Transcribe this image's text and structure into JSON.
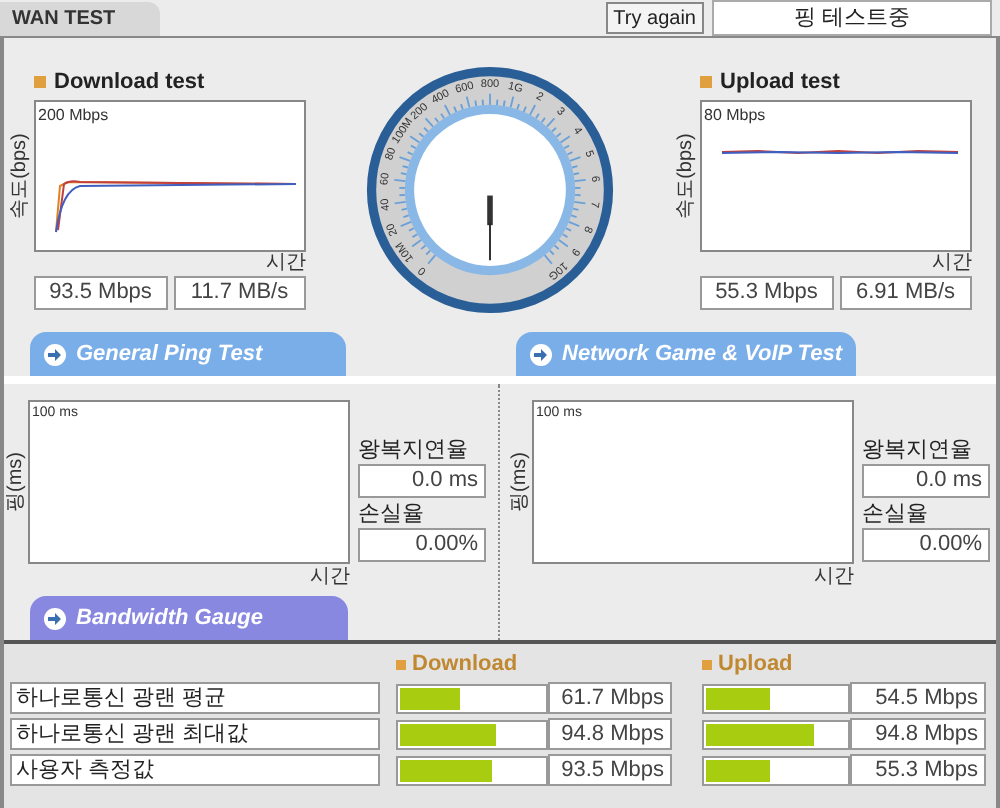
{
  "header": {
    "tab": "WAN TEST",
    "button": "Try again",
    "status": "핑 테스트중"
  },
  "throughput": [
    {
      "kind": "download",
      "title": "Download test",
      "y_label": "속도(bps)",
      "scale": "200 Mbps",
      "x_label": "시간",
      "readings": [
        "93.5 Mbps",
        "11.7 MB/s"
      ]
    },
    {
      "kind": "upload",
      "title": "Upload test",
      "y_label": "속도(bps)",
      "scale": "80 Mbps",
      "x_label": "시간",
      "readings": [
        "55.3 Mbps",
        "6.91 MB/s"
      ]
    }
  ],
  "gauge": {
    "ticks": [
      "0",
      "10M",
      "20",
      "40",
      "60",
      "80",
      "100M",
      "200",
      "400",
      "600",
      "800",
      "1G",
      "2",
      "3",
      "4",
      "5",
      "6",
      "7",
      "8",
      "9",
      "10G"
    ]
  },
  "ping_tests": [
    {
      "tab": "General Ping Test",
      "y_label": "핑(ms)",
      "scale": "100 ms",
      "x_label": "시간",
      "rtt_label": "왕복지연율",
      "rtt": "0.0 ms",
      "loss_label": "손실율",
      "loss": "0.00%"
    },
    {
      "tab": "Network Game & VoIP Test",
      "y_label": "핑(ms)",
      "scale": "100 ms",
      "x_label": "시간",
      "rtt_label": "왕복지연율",
      "rtt": "0.0 ms",
      "loss_label": "손실율",
      "loss": "0.00%"
    }
  ],
  "bandwidth": {
    "tab": "Bandwidth Gauge",
    "columns": [
      "Download",
      "Upload"
    ],
    "rows": [
      {
        "label": "하나로통신 광랜 평균",
        "download": {
          "level": 0.42,
          "value": "61.7 Mbps"
        },
        "upload": {
          "level": 0.45,
          "value": "54.5 Mbps"
        }
      },
      {
        "label": "하나로통신 광랜 최대값",
        "download": {
          "level": 0.66,
          "value": "94.8 Mbps"
        },
        "upload": {
          "level": 0.77,
          "value": "94.8 Mbps"
        }
      },
      {
        "label": "사용자 측정값",
        "download": {
          "level": 0.64,
          "value": "93.5 Mbps"
        },
        "upload": {
          "level": 0.45,
          "value": "55.3 Mbps"
        }
      }
    ]
  }
}
